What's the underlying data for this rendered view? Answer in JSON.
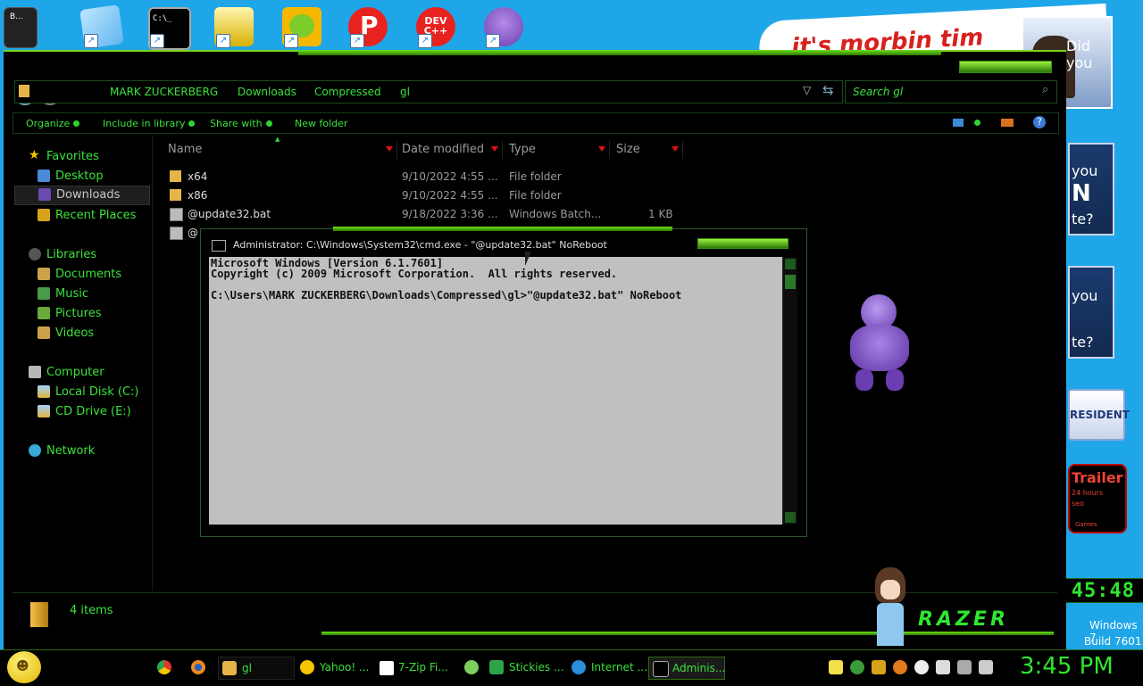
{
  "desktop": {
    "shortcuts": [
      {
        "name": "computer-shortcut",
        "label": "B..."
      },
      {
        "name": "notepad-shortcut",
        "label": ""
      },
      {
        "name": "cmd-shortcut",
        "label": "C:\\_"
      },
      {
        "name": "scanner-shortcut",
        "label": ""
      },
      {
        "name": "bad-piggies-shortcut",
        "label": ""
      },
      {
        "name": "p-app-shortcut",
        "label": "P"
      },
      {
        "name": "dev-cpp-shortcut",
        "label": "DEV C++"
      },
      {
        "name": "bonzi-shortcut",
        "label": ""
      }
    ],
    "banner_text": "it's morbin tim",
    "ads": [
      "Did you",
      "you",
      "N",
      "te?",
      "you",
      "te?",
      "RESIDENT",
      "Trailer",
      "24 hours",
      "seo",
      "Games"
    ],
    "clock_widget": "03:45:48",
    "os_name": "Windows 7",
    "build": "Build 7601",
    "brand": "RAZER"
  },
  "explorer": {
    "breadcrumb": [
      "MARK ZUCKERBERG",
      "Downloads",
      "Compressed",
      "gl"
    ],
    "search_placeholder": "Search gl",
    "commands": [
      "Organize",
      "Include in library",
      "Share with",
      "New folder"
    ],
    "nav": {
      "favorites": "Favorites",
      "desktop": "Desktop",
      "downloads": "Downloads",
      "recent": "Recent Places",
      "libraries": "Libraries",
      "documents": "Documents",
      "music": "Music",
      "pictures": "Pictures",
      "videos": "Videos",
      "computer": "Computer",
      "local_disk": "Local Disk (C:)",
      "cd_drive": "CD Drive (E:)",
      "network": "Network"
    },
    "columns": [
      "Name",
      "Date modified",
      "Type",
      "Size"
    ],
    "files": [
      {
        "name": "x64",
        "date": "9/10/2022 4:55 ...",
        "type": "File folder",
        "size": ""
      },
      {
        "name": "x86",
        "date": "9/10/2022 4:55 ...",
        "type": "File folder",
        "size": ""
      },
      {
        "name": "@update32.bat",
        "date": "9/18/2022 3:36 ...",
        "type": "Windows Batch...",
        "size": "1 KB"
      },
      {
        "name": "@",
        "date": "",
        "type": "",
        "size": ""
      }
    ],
    "status": "4 items"
  },
  "cmd": {
    "title": "Administrator: C:\\Windows\\System32\\cmd.exe - \"@update32.bat\"  NoReboot",
    "lines": [
      "Microsoft Windows [Version 6.1.7601]",
      "Copyright (c) 2009 Microsoft Corporation.  All rights reserved.",
      "",
      "C:\\Users\\MARK ZUCKERBERG\\Downloads\\Compressed\\gl>\"@update32.bat\" NoReboot"
    ]
  },
  "taskbar": {
    "buttons": [
      "gl",
      "Yahoo! ...",
      "7-Zip Fi...",
      "Stickies ...",
      "Internet ...",
      "Adminis..."
    ],
    "clock": "3:45 PM"
  },
  "colors": {
    "accent": "#3be23b",
    "desktop": "#1fa6e8",
    "console": "#c0c0c0"
  }
}
